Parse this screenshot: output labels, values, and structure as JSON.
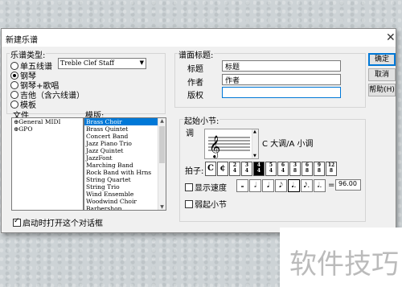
{
  "window": {
    "title": "新建乐谱"
  },
  "staff_type": {
    "group_label": "乐谱类型:",
    "options": [
      {
        "label": "单五线谱",
        "selected": false
      },
      {
        "label": "钢琴",
        "selected": true
      },
      {
        "label": "钢琴+歌唱",
        "selected": false
      },
      {
        "label": "吉他（含六线谱）",
        "selected": false
      },
      {
        "label": "模板",
        "selected": false
      }
    ],
    "staff_select": "Treble Clef Staff"
  },
  "files": {
    "label": "文件",
    "items": [
      "General MIDI",
      "GPO"
    ]
  },
  "templates": {
    "label": "模版:",
    "items": [
      "Brass Choir",
      "Brass Quintet",
      "Concert Band",
      "Jazz Piano Trio",
      "Jazz Quintet",
      "JazzFont",
      "Marching Band",
      "Rock Band with Hrns",
      "String Quartet",
      "String Trio",
      "Wind Ensemble",
      "Woodwind Choir",
      "Barbershop"
    ],
    "selected_index": 0
  },
  "score_title": {
    "group_label": "谱面标题:",
    "fields": [
      {
        "label": "标题",
        "value": "标题"
      },
      {
        "label": "作者",
        "value": "作者"
      },
      {
        "label": "版权",
        "value": ""
      }
    ]
  },
  "start_measure": {
    "group_label": "起始小节:",
    "key_label": "调",
    "key_value": "C 大调/A 小调",
    "time_sig_label": "拍子:",
    "time_signatures": [
      {
        "top": "",
        "bottom": "",
        "symbol": "C"
      },
      {
        "top": "",
        "bottom": "",
        "symbol": "¢"
      },
      {
        "top": "2",
        "bottom": "4",
        "symbol": ""
      },
      {
        "top": "3",
        "bottom": "4",
        "symbol": ""
      },
      {
        "top": "4",
        "bottom": "4",
        "symbol": ""
      },
      {
        "top": "5",
        "bottom": "4",
        "symbol": ""
      },
      {
        "top": "6",
        "bottom": "4",
        "symbol": ""
      },
      {
        "top": "3",
        "bottom": "8",
        "symbol": ""
      },
      {
        "top": "6",
        "bottom": "8",
        "symbol": ""
      },
      {
        "top": "9",
        "bottom": "8",
        "symbol": ""
      },
      {
        "top": "12",
        "bottom": "8",
        "symbol": ""
      }
    ],
    "selected_time_sig_index": 4,
    "show_tempo_label": "显示速度",
    "tempo_notes": [
      "𝅝",
      "𝅗𝅥",
      "𝅘𝅥",
      "𝅘𝅥𝅮",
      "𝅘𝅥.",
      "𝅘𝅥𝅮.",
      "𝅗𝅥."
    ],
    "tempo_selected_index": 4,
    "tempo_equals": "=",
    "tempo_value": "96.00",
    "pickup_label": "弱起小节"
  },
  "buttons": {
    "ok": "确定",
    "cancel": "取消",
    "help": "帮助(H)"
  },
  "footer": {
    "show_dialog_label": "启动时打开这个对话框"
  },
  "watermark": "软件技巧"
}
